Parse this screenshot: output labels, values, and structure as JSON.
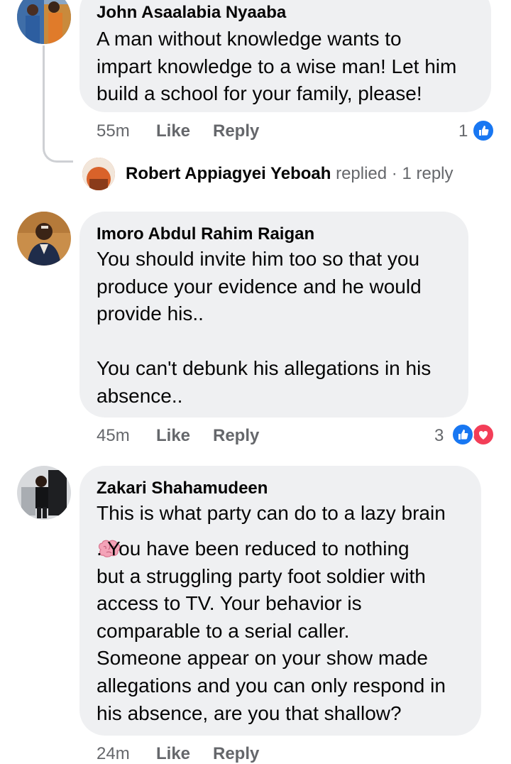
{
  "comments": [
    {
      "name": "John Asaalabia Nyaaba",
      "text": "A man without knowledge wants to\nimpart knowledge to a wise man! Let him\nbuild a school for your family, please!",
      "time": "55m",
      "like_label": "Like",
      "reply_label": "Reply",
      "reaction_count": "1",
      "reactions": [
        "like"
      ],
      "reply_summary": {
        "name": "Robert Appiagyei Yeboah",
        "action": "replied",
        "count": "· 1 reply"
      }
    },
    {
      "name": "Imoro Abdul Rahim Raigan",
      "text": "You should invite him too so that you\nproduce your evidence and he would\nprovide his..\n\nYou can't debunk his allegations in his\nabsence..",
      "time": "45m",
      "like_label": "Like",
      "reply_label": "Reply",
      "reaction_count": "3",
      "reactions": [
        "like",
        "love"
      ]
    },
    {
      "name": "Zakari Shahamudeen",
      "text_line1": "This is what party can do to a lazy brain",
      "emoji": "brain-emoji",
      "text_rest": ". You have been reduced to nothing\nbut a struggling party foot soldier with\naccess to TV. Your behavior is\ncomparable to a serial caller.\nSomeone appear on your show made\nallegations and you can only respond in\nhis absence, are you that shallow?",
      "time": "24m",
      "like_label": "Like",
      "reply_label": "Reply"
    }
  ],
  "colors": {
    "bubble": "#eff0f2",
    "meta": "#65676b",
    "like": "#1877f2",
    "love": "#f33e58"
  }
}
